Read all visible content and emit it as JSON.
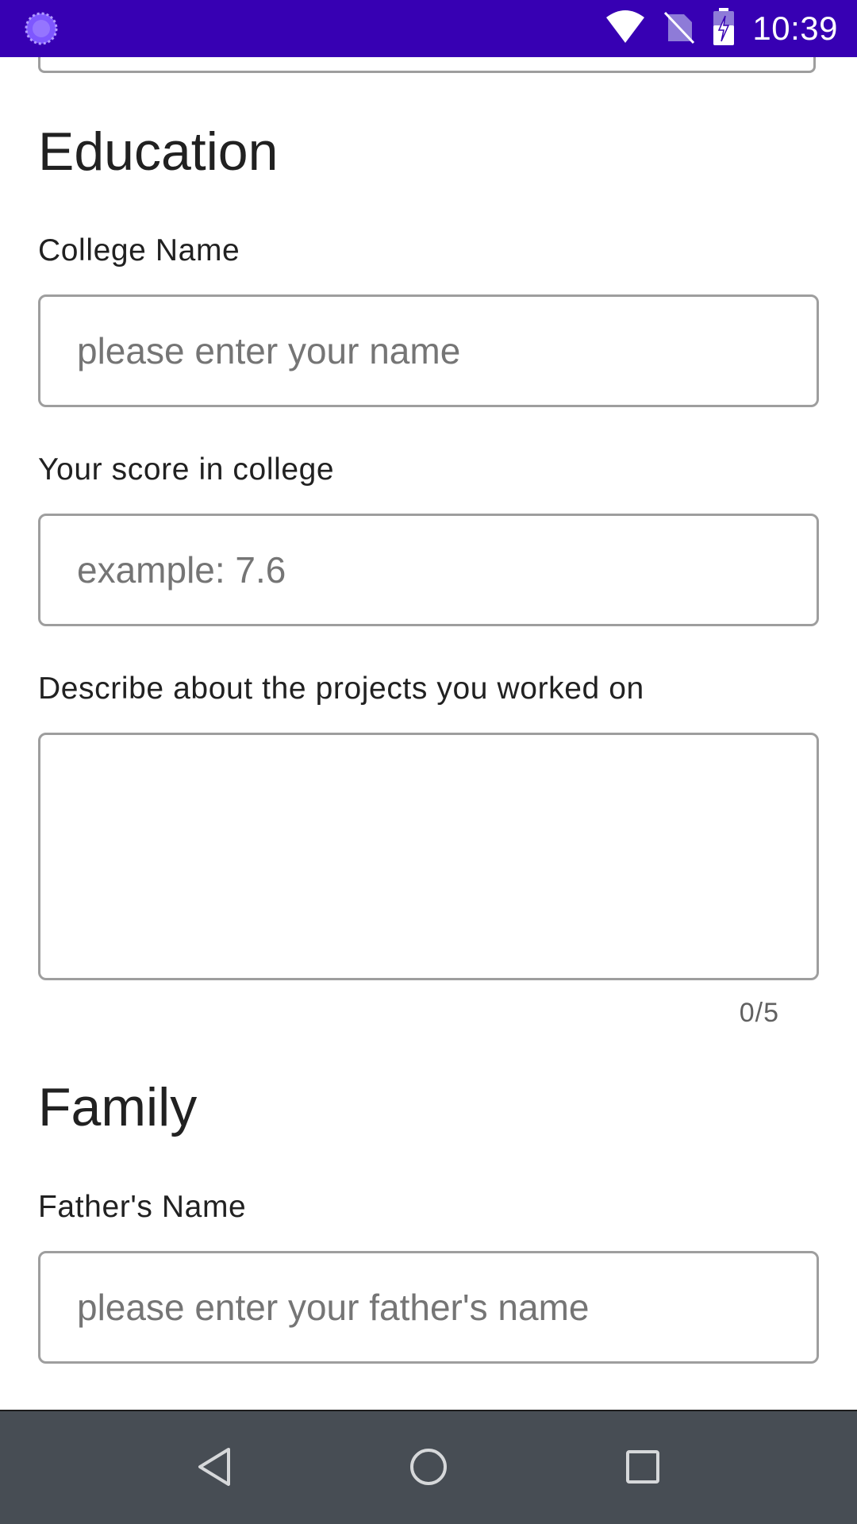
{
  "status_bar": {
    "time": "10:39",
    "background": "#3700b3",
    "icons": [
      "loading-icon",
      "wifi-icon",
      "no-sim-icon",
      "battery-charging-icon"
    ]
  },
  "education": {
    "title": "Education",
    "college_name": {
      "label": "College Name",
      "placeholder": "please enter your name",
      "value": ""
    },
    "score": {
      "label": "Your score in college",
      "placeholder": "example: 7.6",
      "value": ""
    },
    "projects": {
      "label": "Describe about the projects you worked on",
      "value": "",
      "counter": "0/5"
    }
  },
  "family": {
    "title": "Family",
    "father_name": {
      "label": "Father's Name",
      "placeholder": "please enter your father's name",
      "value": ""
    }
  },
  "nav_bar": {
    "background": "#474d54",
    "buttons": [
      "back-icon",
      "home-icon",
      "recents-icon"
    ]
  }
}
